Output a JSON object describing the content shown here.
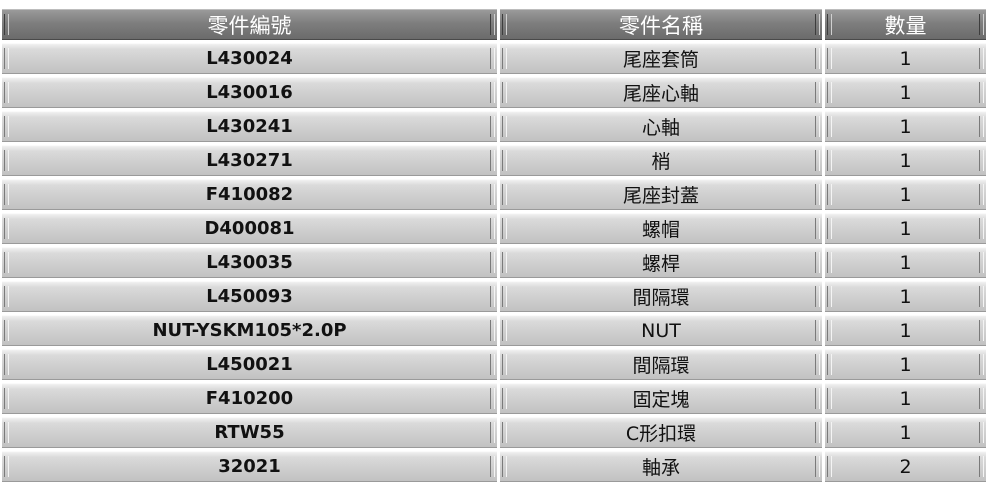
{
  "headers": {
    "part_no": "零件編號",
    "part_name": "零件名稱",
    "qty": "數量"
  },
  "rows": [
    {
      "part_no": "L430024",
      "part_name": "尾座套筒",
      "qty": "1"
    },
    {
      "part_no": "L430016",
      "part_name": "尾座心軸",
      "qty": "1"
    },
    {
      "part_no": "L430241",
      "part_name": "心軸",
      "qty": "1"
    },
    {
      "part_no": "L430271",
      "part_name": "梢",
      "qty": "1"
    },
    {
      "part_no": "F410082",
      "part_name": "尾座封蓋",
      "qty": "1"
    },
    {
      "part_no": "D400081",
      "part_name": "螺帽",
      "qty": "1"
    },
    {
      "part_no": "L430035",
      "part_name": "螺桿",
      "qty": "1"
    },
    {
      "part_no": "L450093",
      "part_name": "間隔環",
      "qty": "1"
    },
    {
      "part_no": "NUT-YSKM105*2.0P",
      "part_name": "NUT",
      "qty": "1"
    },
    {
      "part_no": "L450021",
      "part_name": "間隔環",
      "qty": "1"
    },
    {
      "part_no": "F410200",
      "part_name": "固定塊",
      "qty": "1"
    },
    {
      "part_no": "RTW55",
      "part_name": "C形扣環",
      "qty": "1"
    },
    {
      "part_no": "32021",
      "part_name": "軸承",
      "qty": "2"
    }
  ]
}
